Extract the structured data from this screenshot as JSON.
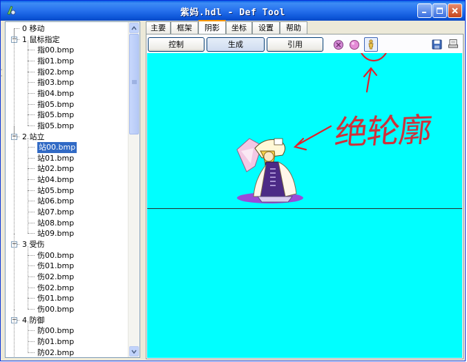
{
  "window": {
    "title": "紫妈.hdl - Def Tool",
    "buttons": [
      "minimize-button",
      "maximize-button",
      "close-button"
    ]
  },
  "tree": {
    "groups": [
      {
        "label": "0 移动",
        "expanded": false,
        "items": []
      },
      {
        "label": "1 鼠标指定",
        "expanded": true,
        "items": [
          "指00.bmp",
          "指01.bmp",
          "指02.bmp",
          "指03.bmp",
          "指04.bmp",
          "指05.bmp",
          "指05.bmp",
          "指05.bmp"
        ]
      },
      {
        "label": "2 站立",
        "expanded": true,
        "items": [
          "站00.bmp",
          "站01.bmp",
          "站02.bmp",
          "站04.bmp",
          "站05.bmp",
          "站06.bmp",
          "站07.bmp",
          "站08.bmp",
          "站09.bmp"
        ]
      },
      {
        "label": "3 受伤",
        "expanded": true,
        "items": [
          "伤00.bmp",
          "伤01.bmp",
          "伤02.bmp",
          "伤02.bmp",
          "伤01.bmp",
          "伤00.bmp"
        ]
      },
      {
        "label": "4 防御",
        "expanded": true,
        "items": [
          "防00.bmp",
          "防01.bmp",
          "防02.bmp"
        ]
      }
    ],
    "selected_item": "站00.bmp"
  },
  "tabs": [
    {
      "label": "主要",
      "active": false
    },
    {
      "label": "框架",
      "active": false
    },
    {
      "label": "阴影",
      "active": true
    },
    {
      "label": "坐标",
      "active": false
    },
    {
      "label": "设置",
      "active": false
    },
    {
      "label": "帮助",
      "active": false
    }
  ],
  "toolbar": {
    "control_label": "控制",
    "generate_label": "生成",
    "reference_label": "引用"
  },
  "annotation": {
    "text": "绝轮廓"
  },
  "colors": {
    "canvas": "#00ffff",
    "annotation": "#e0202a",
    "selection": "#316ac5"
  }
}
